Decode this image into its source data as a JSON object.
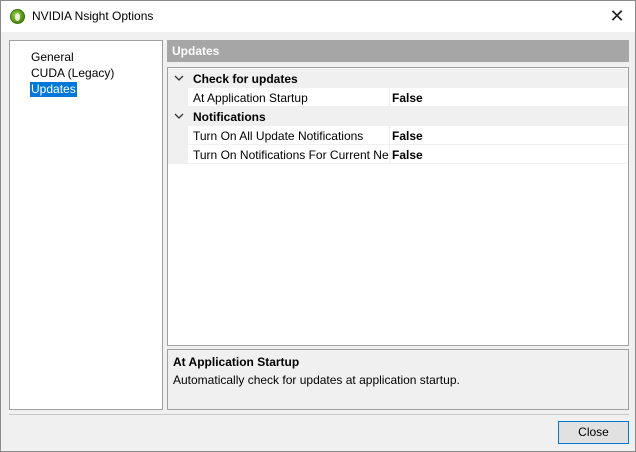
{
  "window": {
    "title": "NVIDIA Nsight Options",
    "close_glyph": "✕"
  },
  "nav": {
    "items": [
      {
        "label": "General"
      },
      {
        "label": "CUDA (Legacy)"
      },
      {
        "label": "Updates",
        "selected": true
      }
    ]
  },
  "panel": {
    "header": "Updates",
    "categories": [
      {
        "label": "Check for updates",
        "properties": [
          {
            "name": "At Application Startup",
            "value": "False"
          }
        ]
      },
      {
        "label": "Notifications",
        "properties": [
          {
            "name": "Turn On All Update Notifications",
            "value": "False"
          },
          {
            "name": "Turn On Notifications For Current Ne",
            "value": "False"
          }
        ]
      }
    ]
  },
  "description": {
    "title": "At Application Startup",
    "text": "Automatically check for updates at application startup."
  },
  "buttons": {
    "close_label": "Close"
  },
  "icons": {
    "app": "nvidia-nsight-icon",
    "collapse": "chevron-down-icon",
    "close": "close-icon"
  },
  "colors": {
    "selection": "#0078d7",
    "header_bg": "#a6a6a6"
  }
}
